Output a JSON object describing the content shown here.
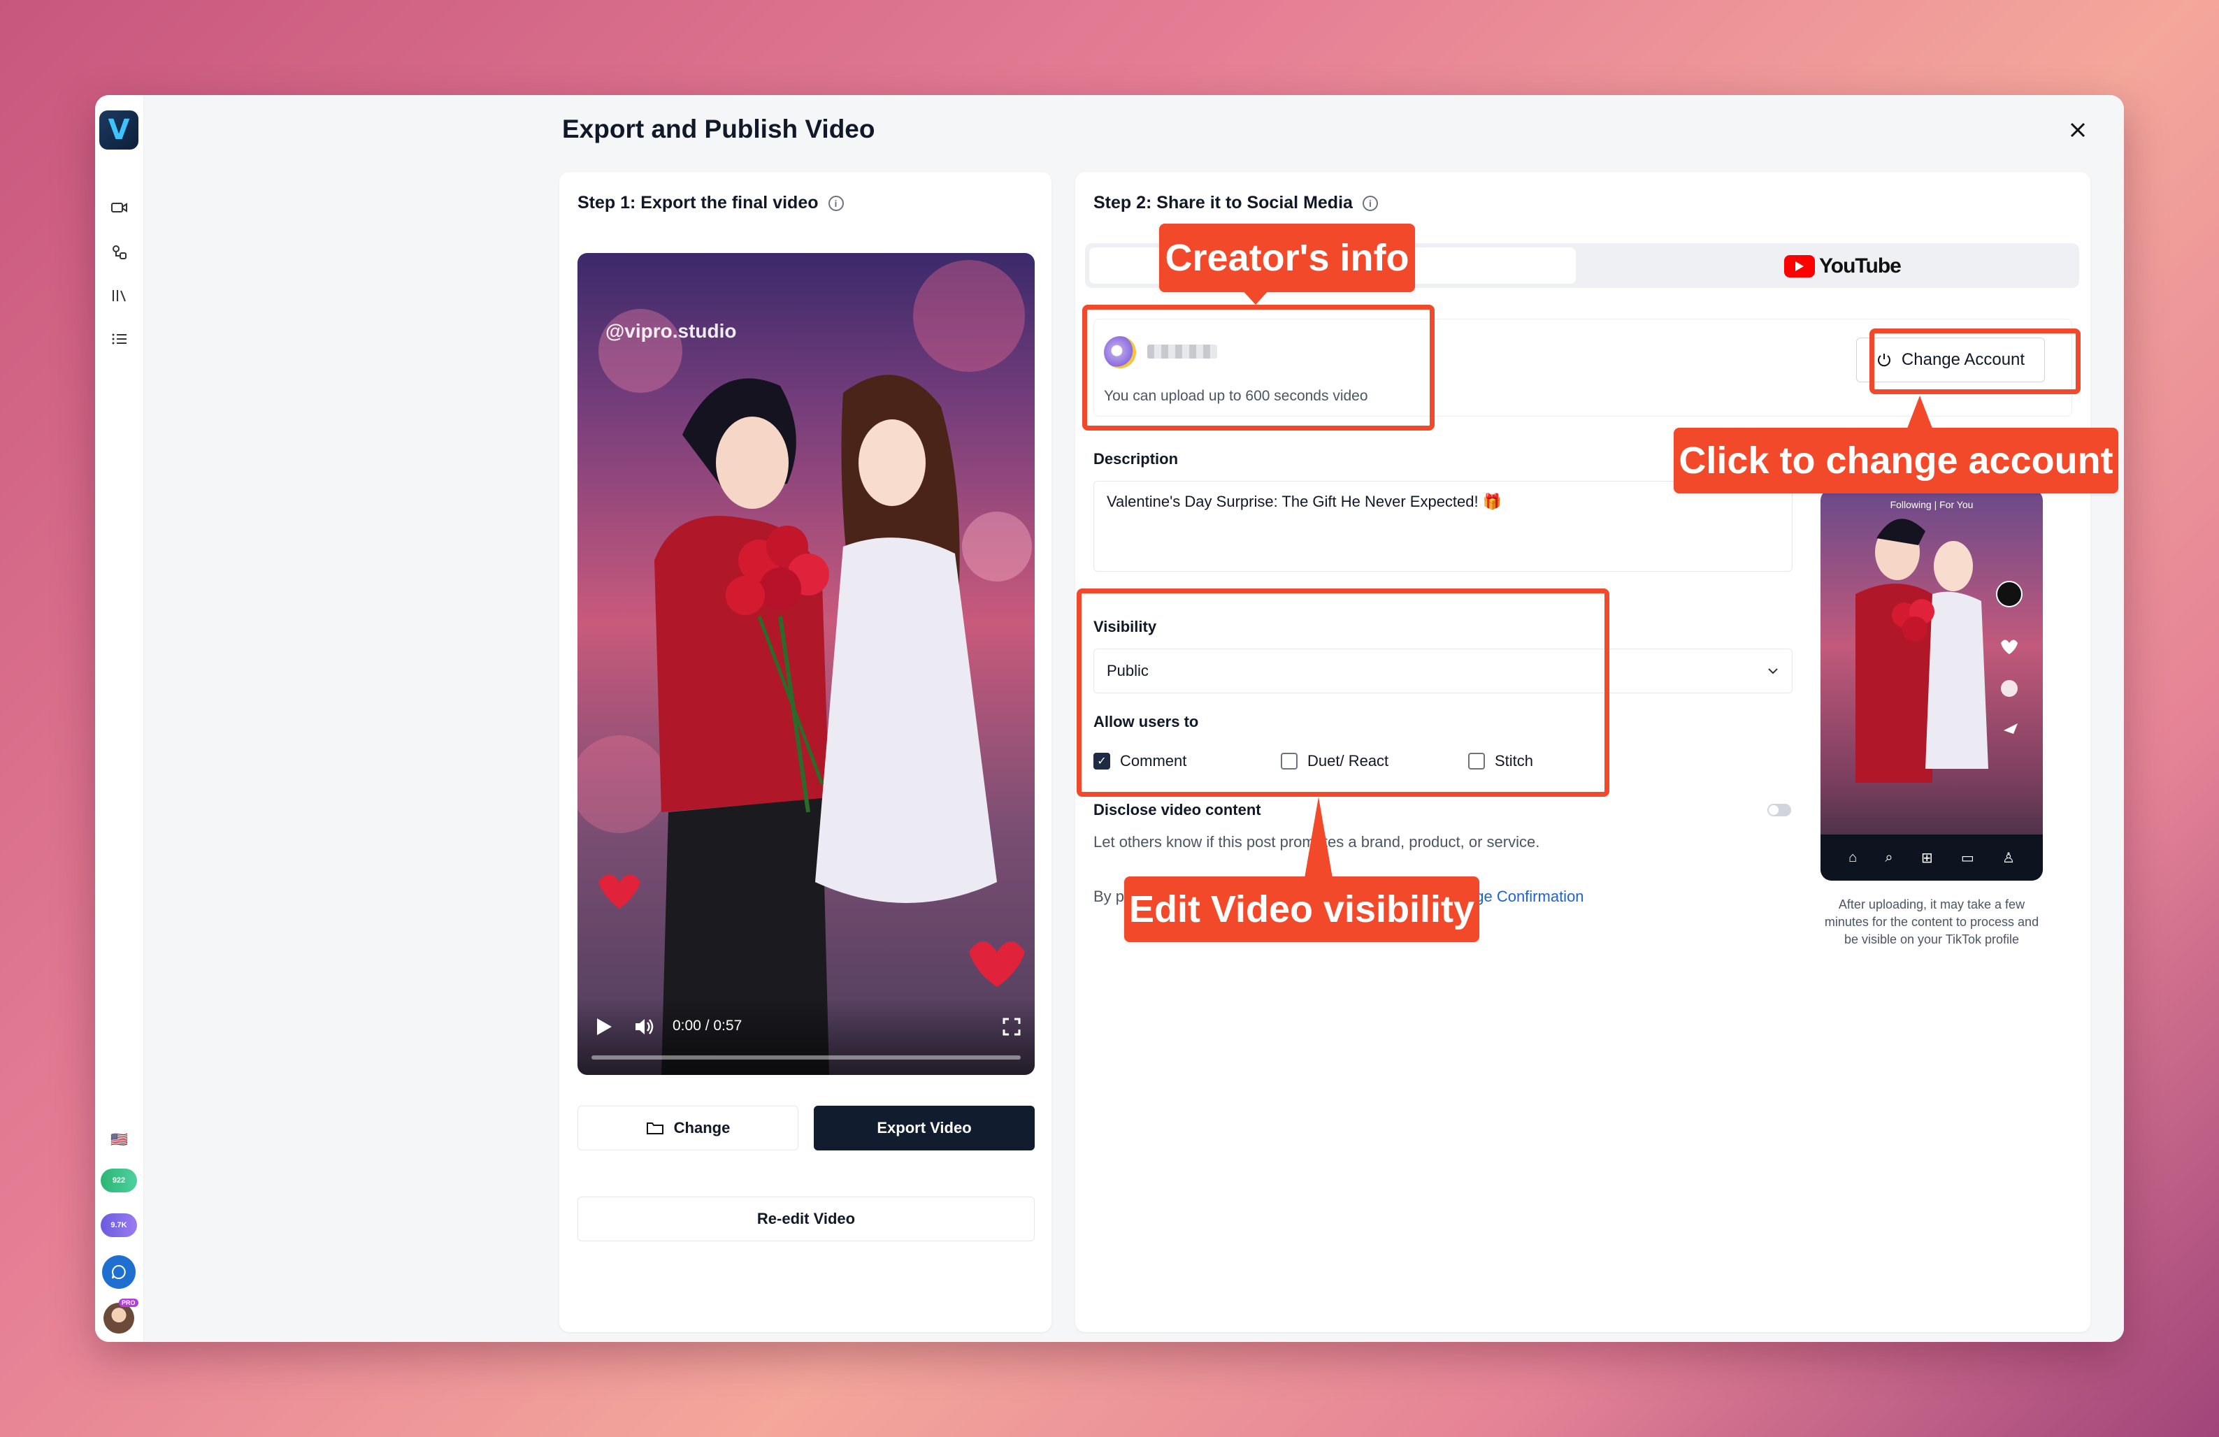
{
  "nav": {
    "logo_letter": "V",
    "badge_credits": "922",
    "badge_gems": "9.7K",
    "pro_tag": "PRO",
    "flag": "🇺🇸"
  },
  "page": {
    "title": "Export and Publish Video"
  },
  "step1": {
    "heading": "Step 1: Export the final video",
    "watermark": "@vipro.studio",
    "time": "0:00 / 0:57",
    "change_label": "Change",
    "export_label": "Export Video",
    "reedit_label": "Re-edit Video"
  },
  "step2": {
    "heading": "Step 2: Share it to Social Media",
    "youtube_label": "YouTube",
    "upload_note": "You can upload up to 600 seconds video",
    "change_account_label": "Change Account",
    "description_label": "Description",
    "description_value": "Valentine's Day Surprise: The Gift He Never Expected! 🎁",
    "visibility_label": "Visibility",
    "visibility_value": "Public",
    "allow_label": "Allow users to",
    "allow_options": [
      {
        "label": "Comment",
        "checked": true
      },
      {
        "label": "Duet/ React",
        "checked": false
      },
      {
        "label": "Stitch",
        "checked": false
      }
    ],
    "disclose_label": "Disclose video content",
    "disclose_note": "Let others know if this post promotes a brand, product, or service.",
    "by_prefix": "By p",
    "confirmation_link": "age Confirmation"
  },
  "preview": {
    "top_tabs": "Following | For You",
    "caption": "After uploading, it may take a few minutes for the content to process and be visible on your TikTok profile"
  },
  "annotations": {
    "creator_info": "Creator's info",
    "change_account": "Click to change account",
    "edit_visibility": "Edit Video visibility"
  },
  "colors": {
    "accent": "#f2492a",
    "primary_dark": "#111c2e",
    "link": "#1d63d3"
  }
}
